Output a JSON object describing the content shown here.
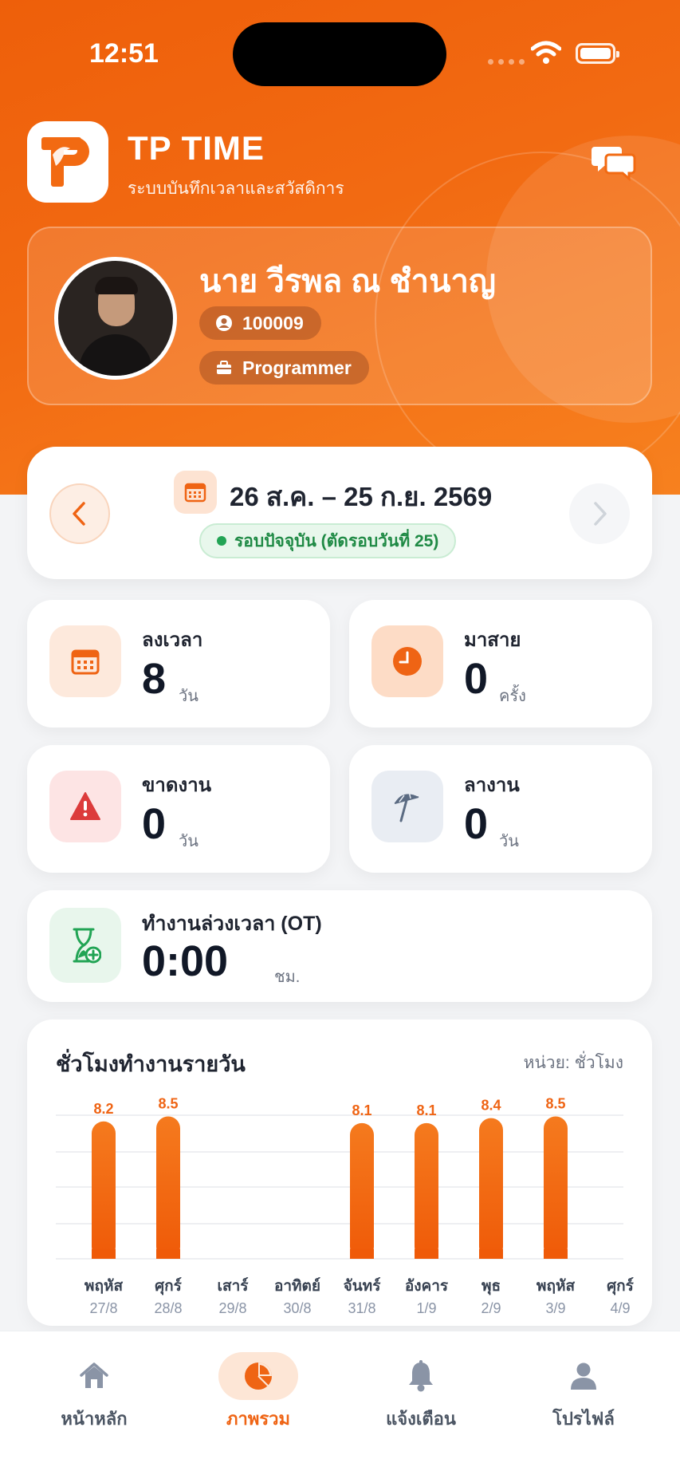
{
  "status_bar": {
    "time": "12:51"
  },
  "app": {
    "title": "TP TIME",
    "subtitle": "ระบบบันทึกเวลาและสวัสดิการ"
  },
  "profile": {
    "name": "นาย วีรพล ณ ชำนาญ",
    "employee_id": "100009",
    "position": "Programmer"
  },
  "period": {
    "range": "26 ส.ค. – 25 ก.ย. 2569",
    "badge": "รอบปัจจุบัน (ตัดรอบวันที่ 25)"
  },
  "stats": {
    "checkin": {
      "label": "ลงเวลา",
      "value": "8",
      "unit": "วัน"
    },
    "late": {
      "label": "มาสาย",
      "value": "0",
      "unit": "ครั้ง"
    },
    "absent": {
      "label": "ขาดงาน",
      "value": "0",
      "unit": "วัน"
    },
    "leave": {
      "label": "ลางาน",
      "value": "0",
      "unit": "วัน"
    },
    "ot": {
      "label": "ทำงานล่วงเวลา (OT)",
      "value": "0:00",
      "unit": "ชม."
    }
  },
  "chart": {
    "title": "ชั่วโมงทำงานรายวัน",
    "unit_label": "หน่วย: ชั่วโมง"
  },
  "chart_data": {
    "type": "bar",
    "categories": [
      "พฤหัส",
      "ศุกร์",
      "เสาร์",
      "อาทิตย์",
      "จันทร์",
      "อังคาร",
      "พุธ",
      "พฤหัส",
      "ศุกร์"
    ],
    "dates": [
      "27/8",
      "28/8",
      "29/8",
      "30/8",
      "31/8",
      "1/9",
      "2/9",
      "3/9",
      "4/9"
    ],
    "values": [
      8.2,
      8.5,
      null,
      null,
      8.1,
      8.1,
      8.4,
      8.5,
      null
    ],
    "color": "#f26a12",
    "grid": true
  },
  "nav": {
    "home": "หน้าหลัก",
    "overview": "ภาพรวม",
    "notifications": "แจ้งเตือน",
    "profile": "โปรไฟล์"
  },
  "colors": {
    "brand": "#f26a12",
    "green": "#22a455",
    "red": "#dc3b3b"
  }
}
